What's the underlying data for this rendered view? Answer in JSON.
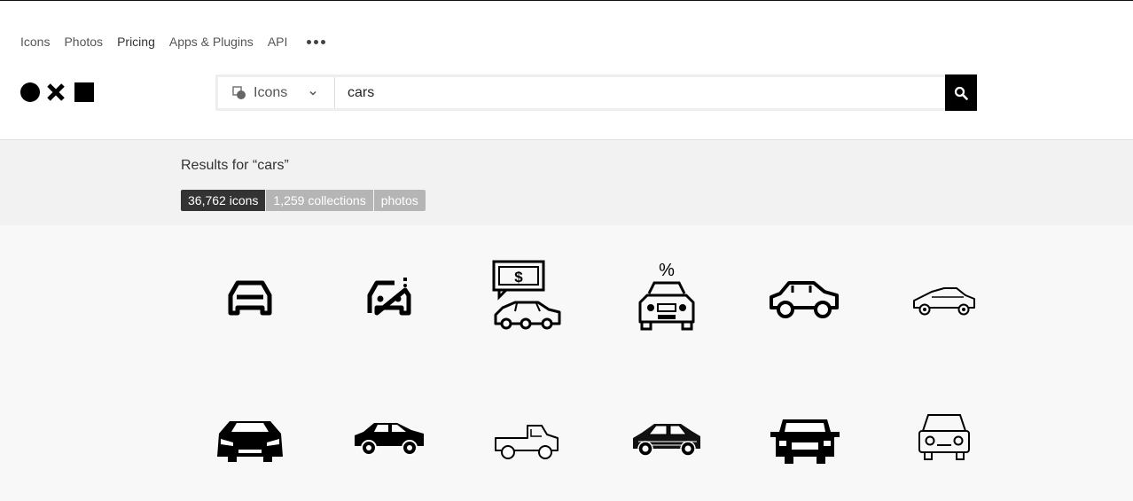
{
  "nav": {
    "items": [
      {
        "label": "Icons"
      },
      {
        "label": "Photos"
      },
      {
        "label": "Pricing"
      },
      {
        "label": "Apps & Plugins"
      },
      {
        "label": "API"
      }
    ],
    "more_icon": "more-dots-icon"
  },
  "logo": {
    "icons": [
      "circle-icon",
      "x-icon",
      "square-icon"
    ]
  },
  "search": {
    "type_label": "Icons",
    "type_icon": "icons-type-icon",
    "query": "cars",
    "button_icon": "search-icon"
  },
  "results": {
    "title": "Results for “cars”",
    "tabs": [
      {
        "label": "36,762 icons",
        "active": true
      },
      {
        "label": "1,259 collections",
        "active": false
      },
      {
        "label": "photos",
        "active": false
      }
    ]
  },
  "icons": [
    "car-front-outline-icon",
    "car-front-alert-icon",
    "car-dollar-icon",
    "car-discount-icon",
    "sedan-side-icon",
    "coupe-side-outline-icon",
    "sports-car-front-icon",
    "hatchback-side-icon",
    "pickup-truck-outline-icon",
    "suv-sketch-icon",
    "classic-car-front-icon",
    "car-front-line-icon"
  ]
}
